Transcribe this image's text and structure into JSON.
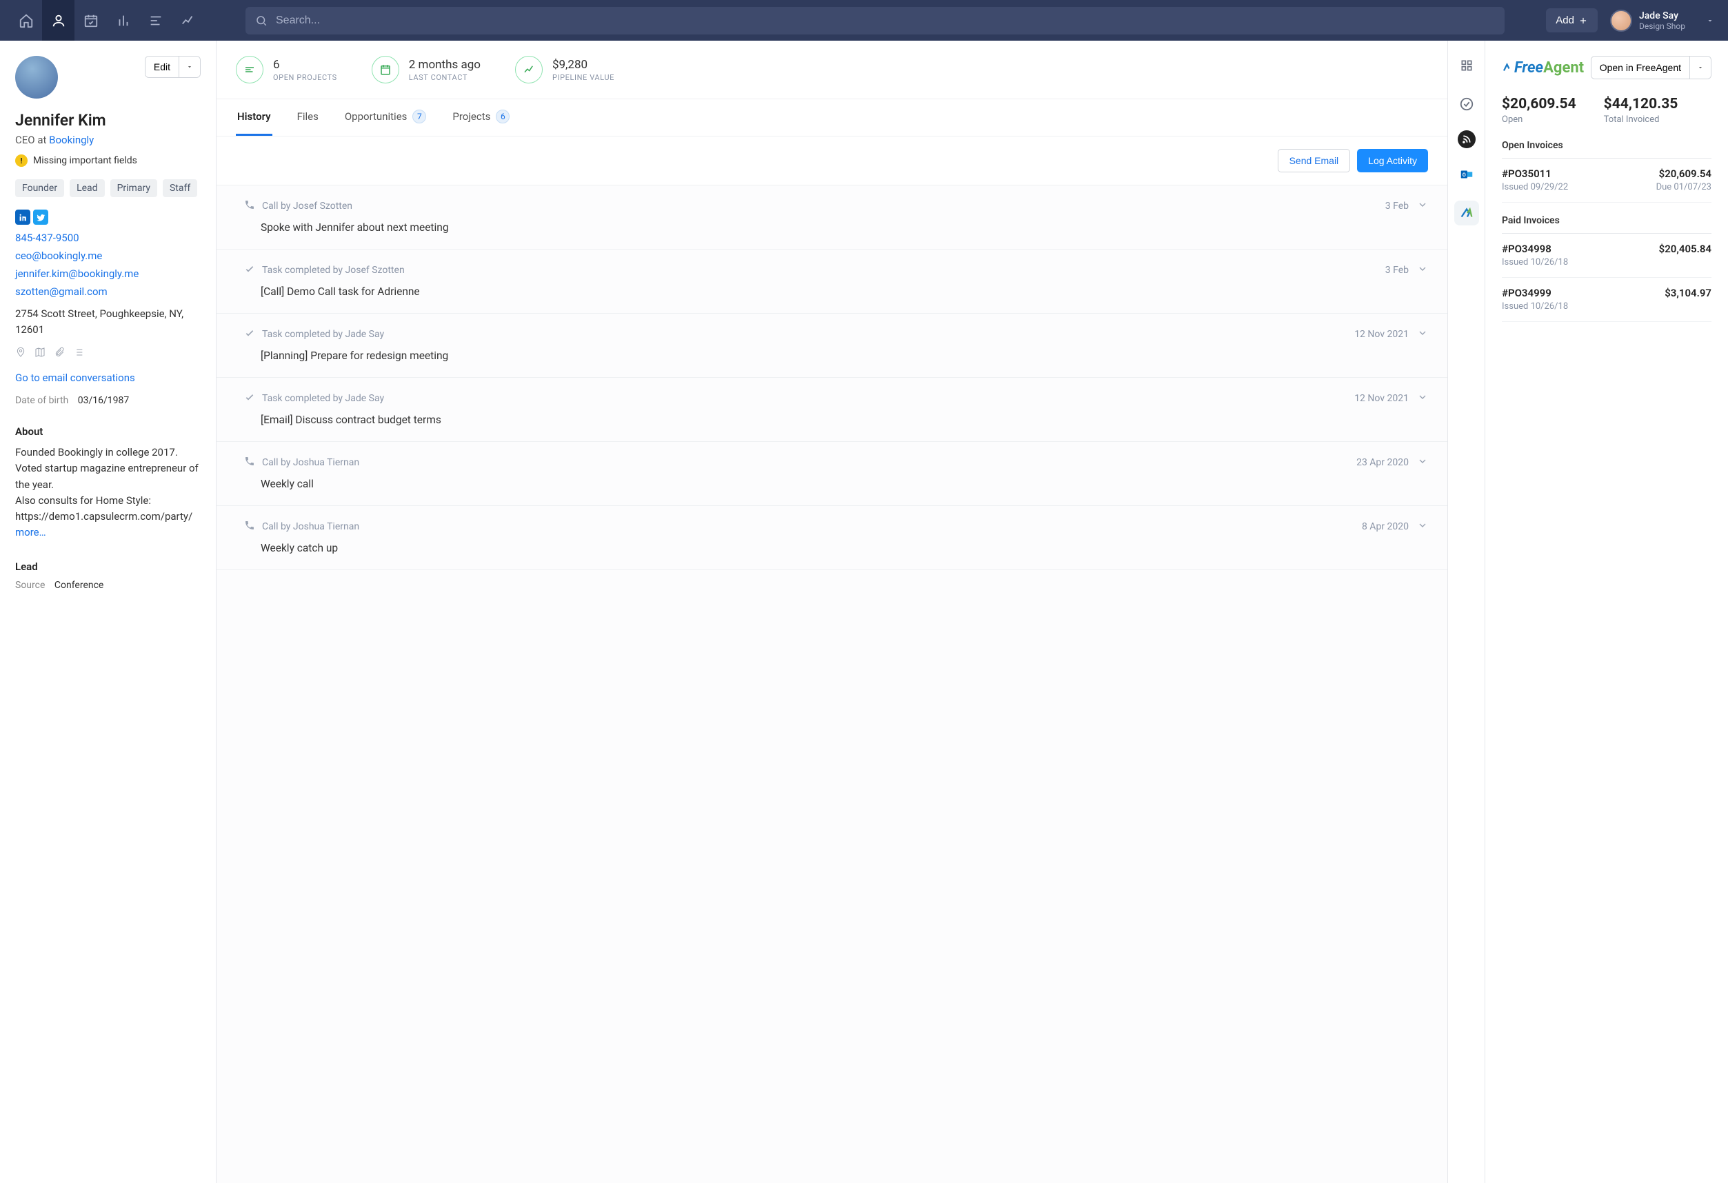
{
  "nav": {
    "search_placeholder": "Search...",
    "add_label": "Add",
    "user_name": "Jade Say",
    "user_org": "Design Shop"
  },
  "left": {
    "edit_label": "Edit",
    "person_name": "Jennifer Kim",
    "role_prefix": "CEO at ",
    "company": "Bookingly",
    "warning_text": "Missing important fields",
    "tags": [
      "Founder",
      "Lead",
      "Primary",
      "Staff"
    ],
    "phone": "845-437-9500",
    "emails": [
      "ceo@bookingly.me",
      "jennifer.kim@bookingly.me",
      "szotten@gmail.com"
    ],
    "address": "2754 Scott Street, Poughkeepsie, NY, 12601",
    "go_email": "Go to email conversations",
    "dob_label": "Date of birth",
    "dob_value": "03/16/1987",
    "about_heading": "About",
    "about_text": "Founded Bookingly in college 2017. Voted startup magazine entrepreneur of the year.\nAlso consults for Home Style: https://demo1.capsulecrm.com/party/",
    "more_label": "more…",
    "lead_heading": "Lead",
    "source_label": "Source",
    "source_value": "Conference"
  },
  "center": {
    "stats": [
      {
        "value": "6",
        "label": "OPEN PROJECTS"
      },
      {
        "value": "2 months ago",
        "label": "LAST CONTACT"
      },
      {
        "value": "$9,280",
        "label": "PIPELINE VALUE"
      }
    ],
    "tabs": [
      {
        "label": "History",
        "active": true
      },
      {
        "label": "Files"
      },
      {
        "label": "Opportunities",
        "count": "7"
      },
      {
        "label": "Projects",
        "count": "6"
      }
    ],
    "actions": {
      "send_email": "Send Email",
      "log_activity": "Log Activity"
    },
    "feed": [
      {
        "icon": "phone",
        "meta": "Call by Josef Szotten",
        "date": "3 Feb",
        "title": "Spoke with Jennifer about next meeting"
      },
      {
        "icon": "check",
        "meta": "Task completed by Josef Szotten",
        "date": "3 Feb",
        "title": "[Call] Demo Call task for Adrienne"
      },
      {
        "icon": "check",
        "meta": "Task completed by Jade Say",
        "date": "12 Nov 2021",
        "title": "[Planning] Prepare for redesign meeting"
      },
      {
        "icon": "check",
        "meta": "Task completed by Jade Say",
        "date": "12 Nov 2021",
        "title": "[Email] Discuss contract budget terms"
      },
      {
        "icon": "phone",
        "meta": "Call by Joshua Tiernan",
        "date": "23 Apr 2020",
        "title": "Weekly call"
      },
      {
        "icon": "phone",
        "meta": "Call by Joshua Tiernan",
        "date": "8 Apr 2020",
        "title": "Weekly catch up"
      }
    ]
  },
  "right": {
    "logo_free": "Free",
    "logo_agent": "Agent",
    "open_label": "Open in FreeAgent",
    "open_amount": "$20,609.54",
    "open_label_sub": "Open",
    "invoiced_amount": "$44,120.35",
    "invoiced_label": "Total Invoiced",
    "open_invoices_heading": "Open Invoices",
    "open_invoices": [
      {
        "id": "#PO35011",
        "amount": "$20,609.54",
        "issued": "Issued 09/29/22",
        "due": "Due 01/07/23"
      }
    ],
    "paid_invoices_heading": "Paid Invoices",
    "paid_invoices": [
      {
        "id": "#PO34998",
        "amount": "$20,405.84",
        "issued": "Issued 10/26/18"
      },
      {
        "id": "#PO34999",
        "amount": "$3,104.97",
        "issued": "Issued 10/26/18"
      }
    ]
  }
}
